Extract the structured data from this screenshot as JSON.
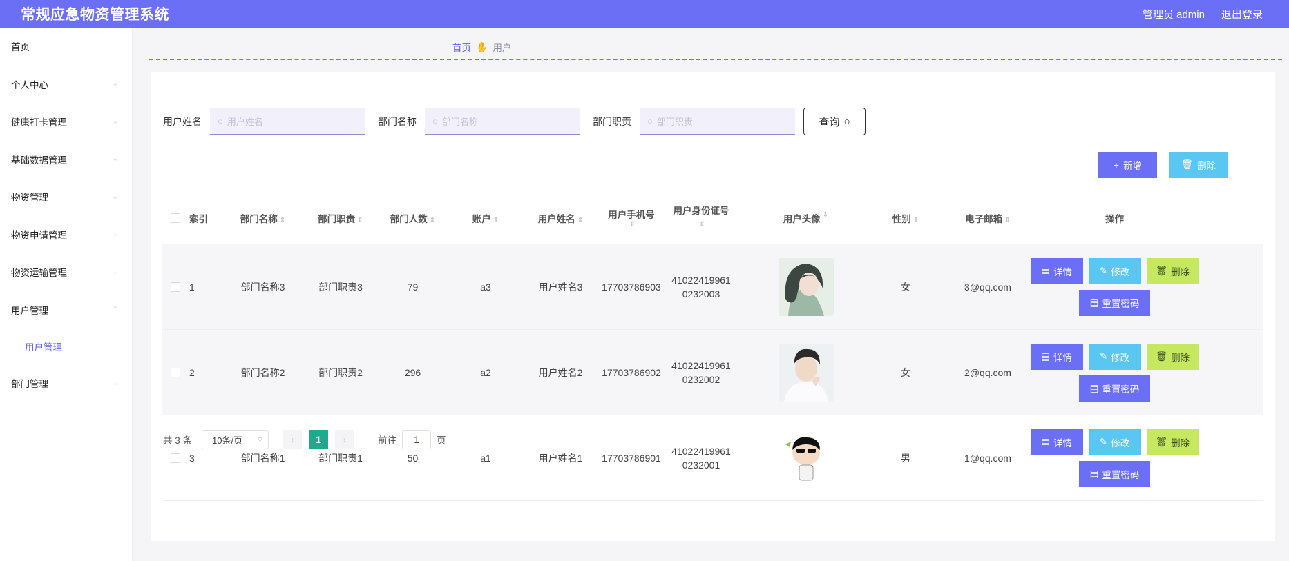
{
  "header": {
    "app_title": "常规应急物资管理系统",
    "user_label": "管理员 admin",
    "logout": "退出登录"
  },
  "sidebar": {
    "items": [
      {
        "label": "首页"
      },
      {
        "label": "个人中心"
      },
      {
        "label": "健康打卡管理"
      },
      {
        "label": "基础数据管理"
      },
      {
        "label": "物资管理"
      },
      {
        "label": "物资申请管理"
      },
      {
        "label": "物资运输管理"
      },
      {
        "label": "用户管理"
      },
      {
        "label": "部门管理"
      }
    ],
    "sub_item": "用户管理"
  },
  "breadcrumb": {
    "home": "首页",
    "current": "用户"
  },
  "search": {
    "username_label": "用户姓名",
    "username_placeholder": "用户姓名",
    "dept_label": "部门名称",
    "dept_placeholder": "部门名称",
    "duty_label": "部门职责",
    "duty_placeholder": "部门职责",
    "query_button": "查询"
  },
  "actions": {
    "add": "新增",
    "delete": "删除"
  },
  "table": {
    "headers": {
      "index": "索引",
      "dept_name": "部门名称",
      "dept_duty": "部门职责",
      "dept_count": "部门人数",
      "account": "账户",
      "user_name": "用户姓名",
      "phone": "用户手机号",
      "id_card": "用户身份证号",
      "avatar": "用户头像",
      "gender": "性别",
      "email": "电子邮箱",
      "ops": "操作"
    },
    "rows": [
      {
        "index": "1",
        "dept_name": "部门名称3",
        "dept_duty": "部门职责3",
        "dept_count": "79",
        "account": "a3",
        "user_name": "用户姓名3",
        "phone": "17703786903",
        "id_line1": "41022419961",
        "id_line2": "0232003",
        "gender": "女",
        "email": "3@qq.com"
      },
      {
        "index": "2",
        "dept_name": "部门名称2",
        "dept_duty": "部门职责2",
        "dept_count": "296",
        "account": "a2",
        "user_name": "用户姓名2",
        "phone": "17703786902",
        "id_line1": "41022419961",
        "id_line2": "0232002",
        "gender": "女",
        "email": "2@qq.com"
      },
      {
        "index": "3",
        "dept_name": "部门名称1",
        "dept_duty": "部门职责1",
        "dept_count": "50",
        "account": "a1",
        "user_name": "用户姓名1",
        "phone": "17703786901",
        "id_line1": "41022419961",
        "id_line2": "0232001",
        "gender": "男",
        "email": "1@qq.com"
      }
    ],
    "op_labels": {
      "detail": "详情",
      "edit": "修改",
      "delete": "删除",
      "reset": "重置密码"
    }
  },
  "pagination": {
    "total": "共 3 条",
    "page_size": "10条/页",
    "current_page": "1",
    "goto_prefix": "前往",
    "goto_value": "1",
    "goto_suffix": "页"
  },
  "colors": {
    "primary": "#6b6ff5",
    "cyan": "#5ac7f2",
    "lime": "#c5e860",
    "pager_active": "#1faa8e"
  }
}
